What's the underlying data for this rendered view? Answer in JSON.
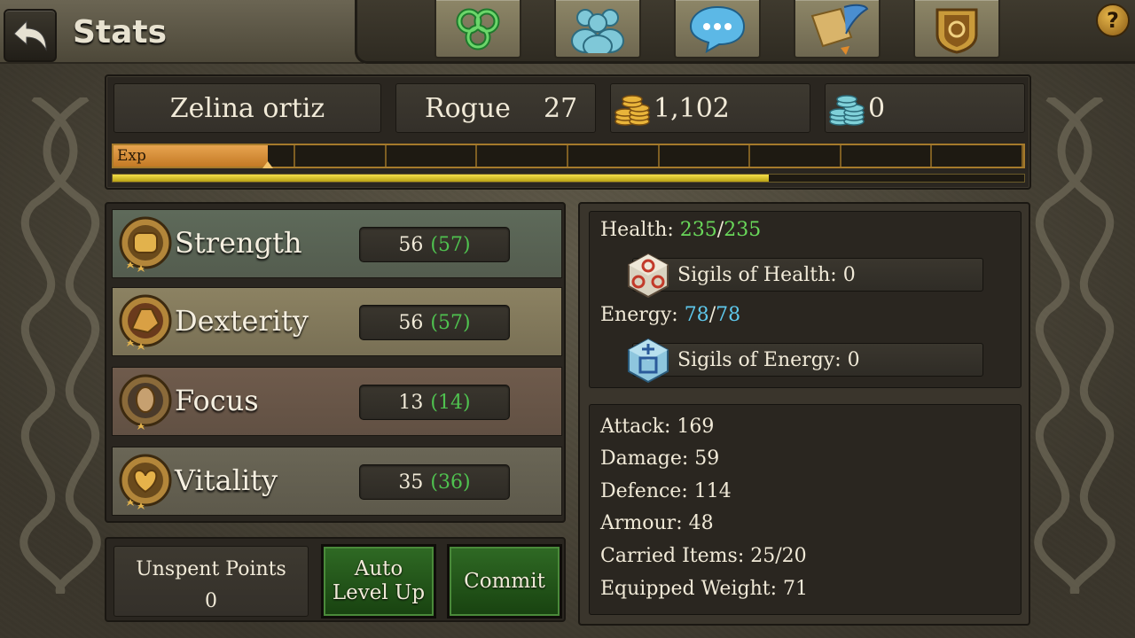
{
  "header": {
    "title": "Stats",
    "nav_icons": [
      "triskele-icon",
      "party-icon",
      "chat-icon",
      "quest-scroll-icon",
      "guild-shield-icon"
    ],
    "help_label": "?"
  },
  "character": {
    "name": "Zelina ortiz",
    "class": "Rogue",
    "level": "27",
    "gold": "1,102",
    "gems": "0"
  },
  "experience": {
    "label": "Exp",
    "segments": 10,
    "fill_fraction": 0.17,
    "progress_fraction": 0.72
  },
  "attributes": [
    {
      "name": "Strength",
      "value": "56",
      "bonus": "(57)",
      "bg": "#5e6a5a"
    },
    {
      "name": "Dexterity",
      "value": "56",
      "bonus": "(57)",
      "bg": "#8c8262"
    },
    {
      "name": "Focus",
      "value": "13",
      "bonus": "(14)",
      "bg": "#6f5b4c"
    },
    {
      "name": "Vitality",
      "value": "35",
      "bonus": "(36)",
      "bg": "#6a6656"
    }
  ],
  "controls": {
    "unspent_label": "Unspent Points",
    "unspent_value": "0",
    "auto_level_line1": "Auto",
    "auto_level_line2": "Level Up",
    "commit_label": "Commit"
  },
  "vitals": {
    "health_label": "Health: ",
    "health_current": "235",
    "health_max": "235",
    "sigils_health": "Sigils of Health: 0",
    "energy_label": "Energy: ",
    "energy_current": "78",
    "energy_max": "78",
    "sigils_energy": "Sigils of Energy: 0"
  },
  "stats": [
    "Attack: 169",
    "Damage: 59",
    "Defence: 114",
    "Armour: 48",
    "Carried Items: 25/20",
    "Equipped Weight: 71"
  ],
  "colors": {
    "bonus_green": "#4fc24f",
    "health_green": "#69d85a",
    "energy_blue": "#5ec8ec",
    "button_green": "#2f6a24"
  }
}
